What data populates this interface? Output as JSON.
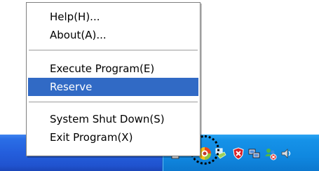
{
  "menu": {
    "items": [
      {
        "label": "Help(H)...",
        "selected": false
      },
      {
        "label": "About(A)...",
        "selected": false
      },
      {
        "label": "Execute Program(E)",
        "selected": false
      },
      {
        "label": "Reserve",
        "selected": true
      },
      {
        "label": "System Shut Down(S)",
        "selected": false
      },
      {
        "label": "Exit Program(X)",
        "selected": false
      }
    ],
    "selection_color": "#316ac5"
  },
  "taskbar": {
    "tray_icons": [
      "keyboard-layout-icon",
      "app-tray-icon",
      "network-icon",
      "security-shield-icon",
      "windows-messenger-icon",
      "users-status-icon",
      "sound-icon"
    ],
    "highlighted_icon": "app-tray-icon",
    "colors": {
      "taskbar": "#245edc",
      "tray": "#1088e0"
    }
  }
}
